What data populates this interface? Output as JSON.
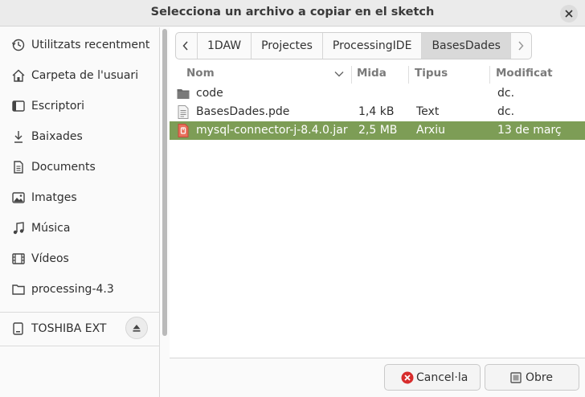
{
  "window": {
    "title": "Selecciona un archivo a copiar en el sketch"
  },
  "sidebar": {
    "items": [
      {
        "label": "Utilitzats recentment",
        "icon": "recent-icon"
      },
      {
        "label": "Carpeta de l'usuari",
        "icon": "home-icon"
      },
      {
        "label": "Escriptori",
        "icon": "desktop-icon"
      },
      {
        "label": "Baixades",
        "icon": "download-icon"
      },
      {
        "label": "Documents",
        "icon": "document-icon"
      },
      {
        "label": "Imatges",
        "icon": "image-icon"
      },
      {
        "label": "Música",
        "icon": "music-icon"
      },
      {
        "label": "Vídeos",
        "icon": "video-icon"
      },
      {
        "label": "processing-4.3",
        "icon": "folder-icon"
      }
    ],
    "device": {
      "label": "TOSHIBA EXT",
      "icon": "drive-icon"
    }
  },
  "pathbar": {
    "segments": [
      "1DAW",
      "Projectes",
      "ProcessingIDE",
      "BasesDades"
    ],
    "active_index": 3
  },
  "columns": {
    "name": "Nom",
    "size": "Mida",
    "type": "Tipus",
    "modified": "Modificat"
  },
  "files": [
    {
      "name": "code",
      "size": "",
      "type": "",
      "modified": "dc.",
      "icon": "folder-icon",
      "selected": false
    },
    {
      "name": "BasesDades.pde",
      "size": "1,4 kB",
      "type": "Text",
      "modified": "dc.",
      "icon": "text-file-icon",
      "selected": false
    },
    {
      "name": "mysql-connector-j-8.4.0.jar",
      "size": "2,5 MB",
      "type": "Arxiu",
      "modified": "13 de març",
      "icon": "archive-file-icon",
      "selected": true
    }
  ],
  "buttons": {
    "cancel": "Cancel·la",
    "open": "Obre"
  },
  "colors": {
    "selection": "#7d9d56",
    "cancel_icon": "#d72c2c"
  }
}
